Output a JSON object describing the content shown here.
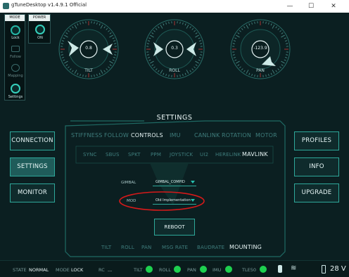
{
  "window": {
    "title": "gTuneDesktop  v1.4.9.1 Official",
    "minimize": "—",
    "maximize": "☐",
    "close": "✕"
  },
  "mode_panel": {
    "header": "MODE",
    "items": [
      {
        "label": "Lock"
      },
      {
        "label": "Follow"
      },
      {
        "label": "Mapping"
      },
      {
        "label": "Settings"
      }
    ]
  },
  "power_panel": {
    "header": "POWER",
    "label": "ON"
  },
  "dials": [
    {
      "name": "TILT",
      "value": "0.8"
    },
    {
      "name": "ROLL",
      "value": "0.3"
    },
    {
      "name": "PAN",
      "value": "-123.9"
    }
  ],
  "left_nav": [
    "CONNECTION",
    "SETTINGS",
    "MONITOR"
  ],
  "right_nav": [
    "PROFILES",
    "INFO",
    "UPGRADE"
  ],
  "settings": {
    "title": "SETTINGS",
    "top_tabs": [
      "STIFFNESS",
      "FOLLOW",
      "CONTROLS",
      "IMU",
      "CANLINK",
      "ROTATION",
      "MOTOR"
    ],
    "active_top_tab": "CONTROLS",
    "sub_tabs": [
      "SYNC",
      "SBUS",
      "SPKT",
      "PPM",
      "JOYSTICK",
      "UI2",
      "HERELINK",
      "MAVLINK"
    ],
    "active_sub_tab": "MAVLINK",
    "gimbal_label": "GIMBAL",
    "gimbal_value": "GIMBAL_COMPID",
    "mod_label": "MOD",
    "mod_value": "Old Implementation",
    "reboot_label": "REBOOT",
    "bottom_tabs": [
      "TILT",
      "ROLL",
      "PAN",
      "MSG RATE",
      "BAUDRATE",
      "MOUNTING"
    ],
    "active_bottom_tab": "MOUNTING"
  },
  "status_bar": {
    "state_label": "STATE",
    "state_value": "NORMAL",
    "mode_label": "MODE",
    "mode_value": "LOCK",
    "rc_label": "RC",
    "rc_value": "...",
    "indicators": [
      "TILT",
      "ROLL",
      "PAN",
      "IMU",
      "TLE50"
    ],
    "voltage": "28 V"
  },
  "colors": {
    "background": "#0b1f21",
    "accent": "#26b6a6",
    "status_ok": "#1ed04f",
    "highlight_ring": "#d51a1a"
  }
}
